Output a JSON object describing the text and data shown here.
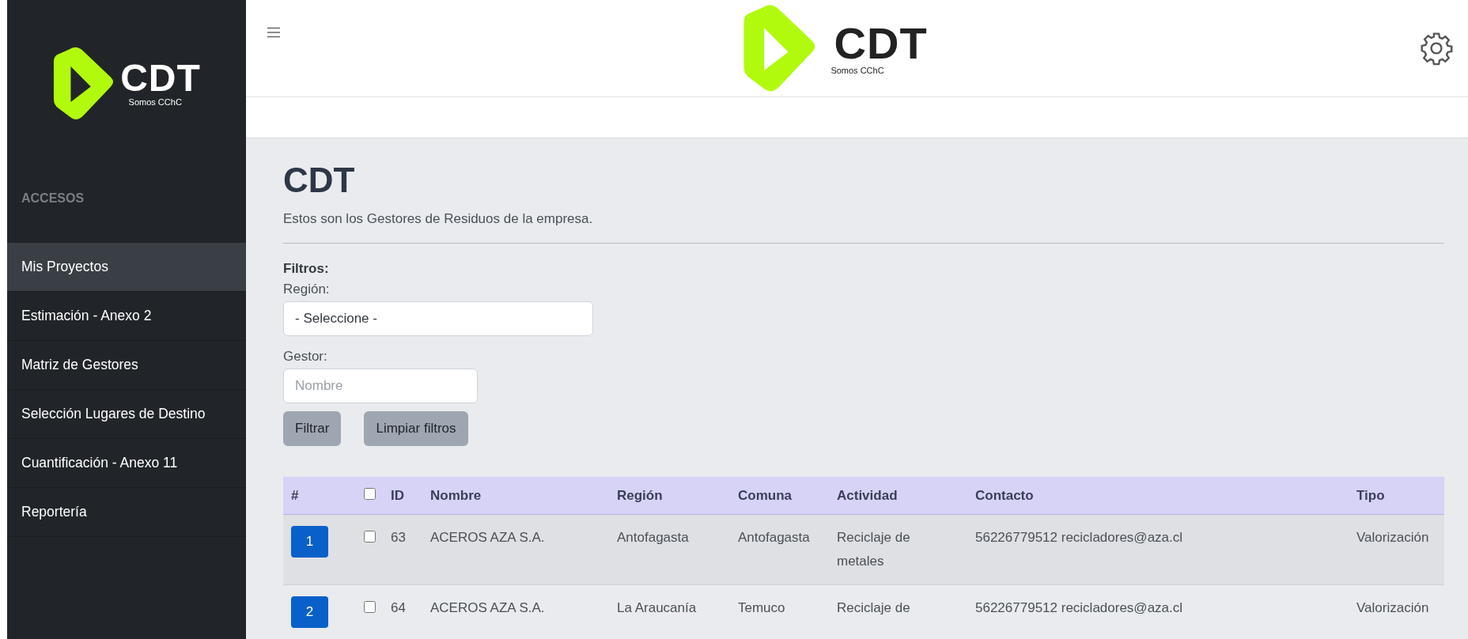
{
  "sidebar": {
    "logo": {
      "title": "CDT",
      "subtitle": "Somos CChC"
    },
    "section_title": "ACCESOS",
    "items": [
      {
        "label": "Mis Proyectos",
        "selected": true
      },
      {
        "label": "Estimación - Anexo 2",
        "selected": false
      },
      {
        "label": "Matriz de Gestores",
        "selected": false
      },
      {
        "label": "Selección Lugares de Destino",
        "selected": false
      },
      {
        "label": "Cuantificación - Anexo 11",
        "selected": false
      },
      {
        "label": "Reportería",
        "selected": false
      }
    ]
  },
  "header": {
    "logo": {
      "title": "CDT",
      "subtitle": "Somos CChC"
    }
  },
  "page": {
    "title": "CDT",
    "description": "Estos son los Gestores de Residuos de la empresa."
  },
  "filters": {
    "title": "Filtros:",
    "region_label": "Región:",
    "region_value": "- Seleccione -",
    "gestor_label": "Gestor:",
    "gestor_placeholder": "Nombre",
    "buttons": [
      "Filtrar",
      "Limpiar filtros"
    ]
  },
  "table": {
    "columns": [
      "#",
      "ID",
      "Nombre",
      "Región",
      "Comuna",
      "Actividad",
      "Contacto",
      "Tipo"
    ],
    "all_checked": false,
    "rows": [
      {
        "number": "1",
        "checked": false,
        "id": "63",
        "nombre": "ACEROS AZA S.A.",
        "region": "Antofagasta",
        "comuna": "Antofagasta",
        "actividad": "Reciclaje de metales",
        "contacto": "56226779512 recicladores@aza.cl",
        "tipo": "Valorización"
      },
      {
        "number": "2",
        "checked": false,
        "id": "64",
        "nombre": "ACEROS AZA S.A.",
        "region": "La Araucanía",
        "comuna": "Temuco",
        "actividad": "Reciclaje de",
        "contacto": "56226779512 recicladores@aza.cl",
        "tipo": "Valorización"
      }
    ]
  }
}
